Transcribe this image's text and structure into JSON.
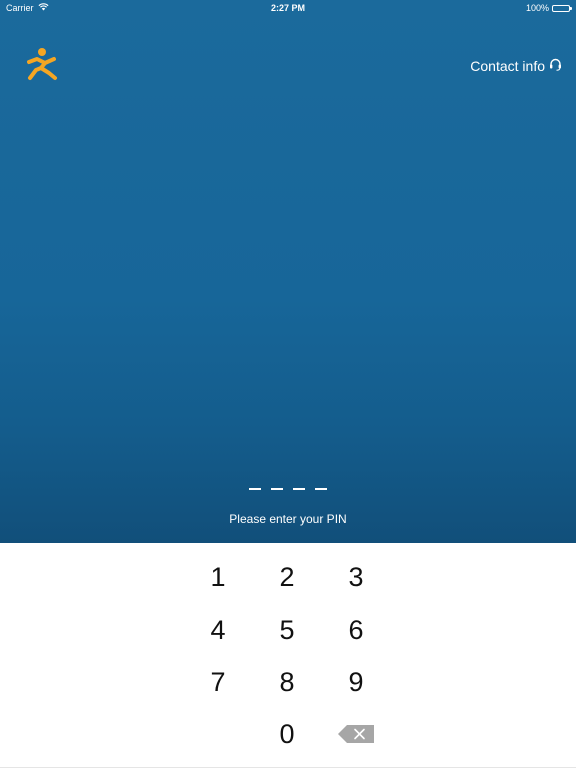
{
  "status_bar": {
    "carrier": "Carrier",
    "time": "2:27 PM",
    "battery": "100%"
  },
  "header": {
    "logo_icon": "running-person-icon",
    "contact_label": "Contact info",
    "contact_icon": "headset-icon"
  },
  "pin": {
    "length": 4,
    "prompt": "Please enter your PIN"
  },
  "keypad": {
    "keys": [
      "1",
      "2",
      "3",
      "4",
      "5",
      "6",
      "7",
      "8",
      "9",
      "0"
    ],
    "backspace_icon": "backspace-icon"
  },
  "colors": {
    "background_top": "#1b6a9c",
    "background_bottom": "#114f7a",
    "logo_orange": "#f5a623",
    "keypad_bg": "#ffffff",
    "key_text": "#111111",
    "backspace_gray": "#a6a6a6"
  }
}
